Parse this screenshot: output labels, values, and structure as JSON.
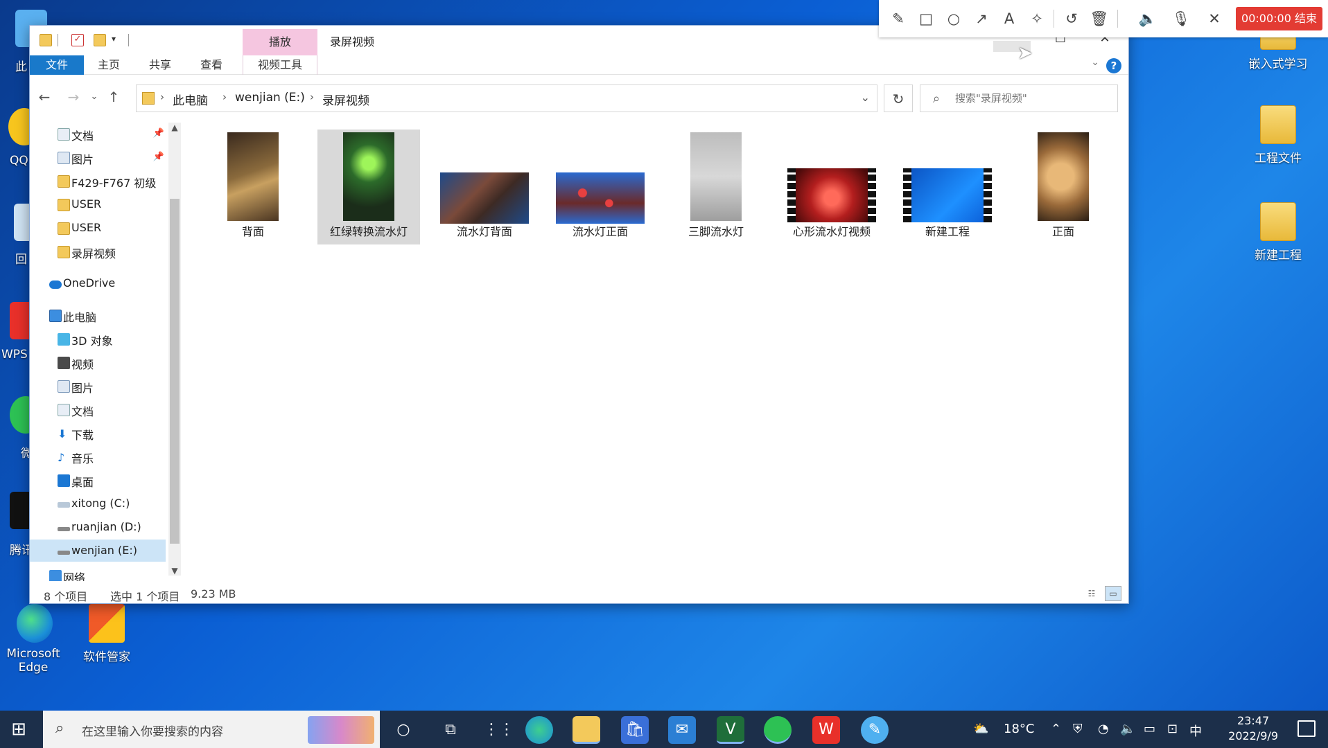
{
  "desktop": {
    "right_icons": [
      {
        "label": "嵌入式学习"
      },
      {
        "label": "工程文件"
      },
      {
        "label": "新建工程"
      }
    ],
    "bottom_icons": [
      {
        "label": "Microsoft Edge"
      },
      {
        "label": "软件管家"
      }
    ],
    "left_labels": [
      "此",
      "QQ",
      "回",
      "WPS",
      "微",
      "腾讯"
    ]
  },
  "recorder": {
    "tools": [
      "pencil-icon",
      "rect-icon",
      "circle-icon",
      "arrow-icon",
      "text-icon",
      "magic-icon",
      "undo-icon",
      "delete-icon",
      "speaker-icon",
      "mic-icon",
      "close-icon"
    ],
    "timer_button": "00:00:00 结束"
  },
  "window": {
    "title": "录屏视频",
    "context_tab": "播放",
    "context_subtab": "视频工具",
    "ribbon_tabs": [
      "文件",
      "主页",
      "共享",
      "查看"
    ],
    "breadcrumb": [
      "此电脑",
      "wenjian (E:)",
      "录屏视频"
    ],
    "search_placeholder": "搜索\"录屏视频\"",
    "help": "?"
  },
  "nav": {
    "items": [
      {
        "label": "文档",
        "icon": "documents-icon",
        "pinned": true
      },
      {
        "label": "图片",
        "icon": "pictures-icon",
        "pinned": true
      },
      {
        "label": "F429-F767 初级",
        "icon": "folder-icon"
      },
      {
        "label": "USER",
        "icon": "folder-icon"
      },
      {
        "label": "USER",
        "icon": "folder-icon"
      },
      {
        "label": "录屏视频",
        "icon": "folder-icon"
      },
      {
        "label": "OneDrive",
        "icon": "onedrive-icon"
      },
      {
        "label": "此电脑",
        "icon": "this-pc-icon"
      },
      {
        "label": "3D 对象",
        "icon": "3d-objects-icon"
      },
      {
        "label": "视频",
        "icon": "videos-icon"
      },
      {
        "label": "图片",
        "icon": "pictures-icon"
      },
      {
        "label": "文档",
        "icon": "documents-icon"
      },
      {
        "label": "下载",
        "icon": "downloads-icon"
      },
      {
        "label": "音乐",
        "icon": "music-icon"
      },
      {
        "label": "桌面",
        "icon": "desktop-icon"
      },
      {
        "label": "xitong (C:)",
        "icon": "drive-c-icon"
      },
      {
        "label": "ruanjian (D:)",
        "icon": "drive-icon"
      },
      {
        "label": "wenjian (E:)",
        "icon": "drive-icon",
        "selected": true
      },
      {
        "label": "网络",
        "icon": "network-icon"
      }
    ]
  },
  "files": [
    {
      "name": "背面",
      "thumb": "photo-board-back"
    },
    {
      "name": "红绿转换流水灯",
      "thumb": "photo-green-leds",
      "selected": true
    },
    {
      "name": "流水灯背面",
      "thumb": "photo-wiring"
    },
    {
      "name": "流水灯正面",
      "thumb": "photo-red-leds"
    },
    {
      "name": "三脚流水灯",
      "thumb": "photo-led-part"
    },
    {
      "name": "心形流水灯视频",
      "thumb": "video-heart"
    },
    {
      "name": "新建工程",
      "thumb": "video-desktop"
    },
    {
      "name": "正面",
      "thumb": "photo-board-front"
    }
  ],
  "status": {
    "count": "8 个项目",
    "selected": "选中 1 个项目",
    "size": "9.23 MB"
  },
  "taskbar": {
    "search_text": "在这里输入你要搜索的内容",
    "weather": "18°C",
    "ime": "中",
    "time": "23:47",
    "date": "2022/9/9"
  },
  "colors": {
    "ribbon_file": "#1979ca",
    "context_tab": "#f5c6e0",
    "record_button": "#e33b33",
    "selection": "#cce4f7"
  }
}
